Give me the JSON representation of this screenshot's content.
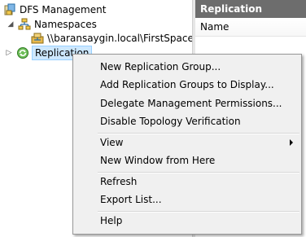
{
  "tree": {
    "root": {
      "label": "DFS Management"
    },
    "namespaces": {
      "label": "Namespaces"
    },
    "namespace_item": {
      "label": "\\\\baransaygin.local\\FirstSpace"
    },
    "replication": {
      "label": "Replication"
    }
  },
  "right_pane": {
    "header": "Replication",
    "column": "Name"
  },
  "context_menu": {
    "items": [
      {
        "label": "New Replication Group..."
      },
      {
        "label": "Add Replication Groups to Display..."
      },
      {
        "label": "Delegate Management Permissions..."
      },
      {
        "label": "Disable Topology Verification"
      },
      {
        "label": "View"
      },
      {
        "label": "New Window from Here"
      },
      {
        "label": "Refresh"
      },
      {
        "label": "Export List..."
      },
      {
        "label": "Help"
      }
    ]
  },
  "colors": {
    "selection_bg": "#cde8ff",
    "header_bg": "#6d6d6d",
    "menu_bg": "#f0f0f0"
  },
  "icons": [
    "dfs-management-icon",
    "namespaces-icon",
    "namespace-server-icon",
    "replication-icon",
    "submenu-arrow-icon"
  ]
}
